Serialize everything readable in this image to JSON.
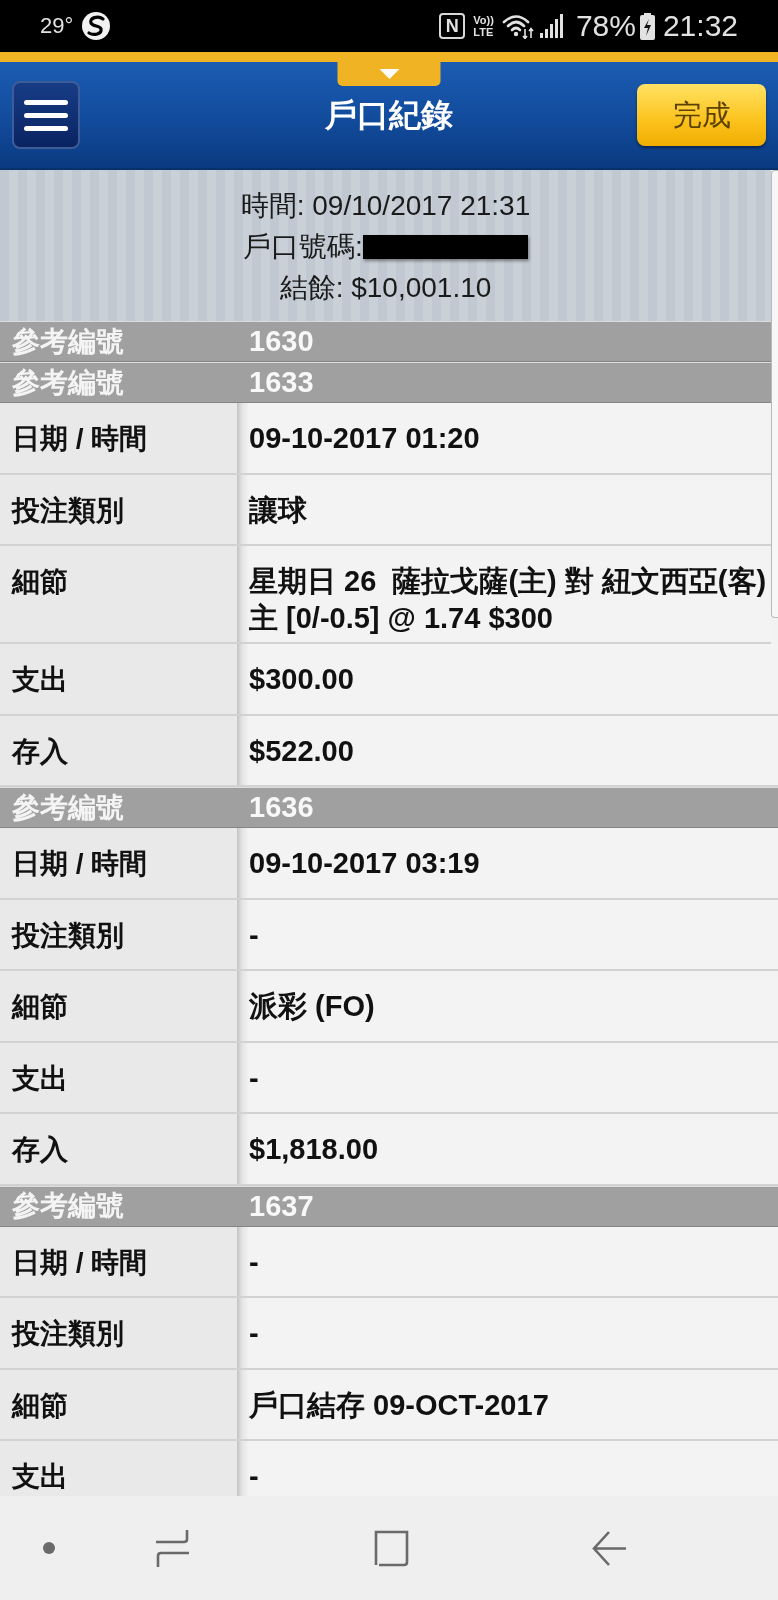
{
  "status_bar": {
    "temperature": "29°",
    "nfc": "N",
    "volte_top": "Vo))",
    "volte_bottom": "LTE",
    "battery": "78%",
    "time": "21:32"
  },
  "header": {
    "title": "戶口紀錄",
    "done_button": "完成"
  },
  "summary": {
    "time": "時間: 09/10/2017 21:31",
    "account_label": "戶口號碼:",
    "balance": "結餘: $10,001.10"
  },
  "records": [
    {
      "ref_label": "參考編號",
      "ref_number": "1630"
    },
    {
      "ref_label": "參考編號",
      "ref_number": "1633",
      "fields": [
        {
          "label": "日期 / 時間",
          "value": "09-10-2017 01:20"
        },
        {
          "label": "投注類別",
          "value": "讓球"
        },
        {
          "label": "細節",
          "value": "星期日 26  薩拉戈薩(主) 對 紐文西亞(客)\n主 [0/-0.5] @ 1.74 $300"
        },
        {
          "label": "支出",
          "value": "$300.00"
        },
        {
          "label": "存入",
          "value": "$522.00"
        }
      ]
    },
    {
      "ref_label": "參考編號",
      "ref_number": "1636",
      "fields": [
        {
          "label": "日期 / 時間",
          "value": "09-10-2017 03:19"
        },
        {
          "label": "投注類別",
          "value": "-"
        },
        {
          "label": "細節",
          "value": "派彩 (FO)"
        },
        {
          "label": "支出",
          "value": "-"
        },
        {
          "label": "存入",
          "value": "$1,818.00"
        }
      ]
    },
    {
      "ref_label": "參考編號",
      "ref_number": "1637",
      "fields": [
        {
          "label": "日期 / 時間",
          "value": "-"
        },
        {
          "label": "投注類別",
          "value": "-"
        },
        {
          "label": "細節",
          "value": "戶口結存 09-OCT-2017"
        },
        {
          "label": "支出",
          "value": "-"
        }
      ]
    }
  ]
}
